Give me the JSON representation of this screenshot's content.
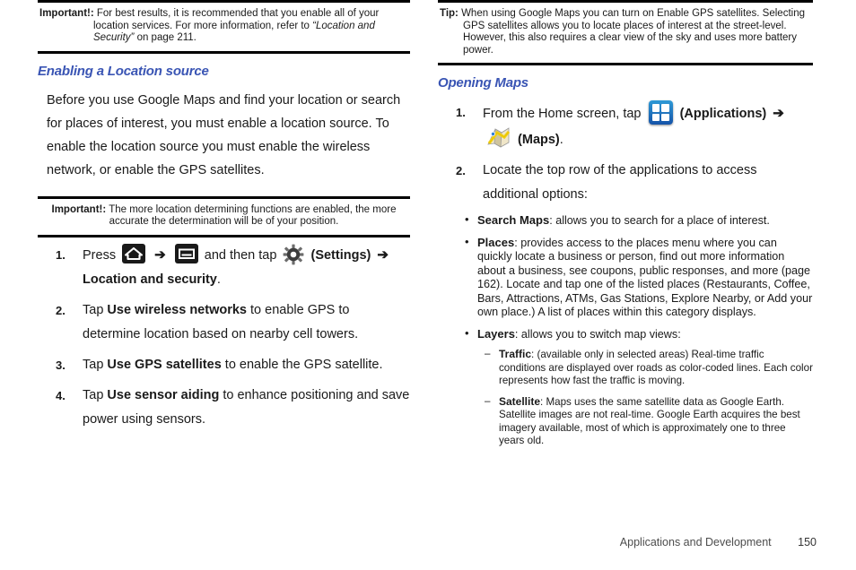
{
  "left_column": {
    "note_important_1": {
      "label": "Important!:",
      "text_a": "For best results, it is recommended that you enable all of your location services. For more information, refer to ",
      "text_italic": "“Location and Security”",
      "text_b": " on page 211."
    },
    "heading": "Enabling a Location source",
    "paragraph": "Before you use Google Maps and find your location or search for places of interest, you must enable a location source. To enable the location source you must enable the wireless network, or enable the GPS satellites.",
    "note_important_2": {
      "label": "Important!:",
      "line1": "The more location determining functions are enabled, the more",
      "line2": "accurate the determination will be of your position."
    },
    "steps": [
      {
        "num": "1.",
        "pre": "Press",
        "home_icon": "home-icon",
        "arrow1": "➔",
        "menu_icon": "menu-icon",
        "mid": "and then tap",
        "gear_icon": "settings-gear-icon",
        "paren_settings": "(Settings)",
        "arrow2": "➔",
        "bold_tail": "Location and security",
        "tail_punct": "."
      },
      {
        "num": "2.",
        "pre": "Tap ",
        "bold": "Use wireless networks",
        "post": " to enable GPS to determine location based on nearby cell towers."
      },
      {
        "num": "3.",
        "pre": "Tap ",
        "bold": "Use GPS satellites",
        "post": " to enable the GPS satellite."
      },
      {
        "num": "4.",
        "pre": "Tap ",
        "bold": "Use sensor aiding",
        "post": " to enhance positioning and save power using sensors."
      }
    ]
  },
  "right_column": {
    "note_tip": {
      "label": "Tip:",
      "text": "When using Google Maps you can turn on Enable GPS satellites. Selecting GPS satellites allows you to locate places of interest at the street-level. However, this also requires a clear view of the sky and uses more battery power."
    },
    "heading": "Opening Maps",
    "steps": [
      {
        "num": "1.",
        "pre": "From the Home screen, tap",
        "apps_icon": "applications-icon",
        "paren_apps": "(Applications)",
        "arrow": "➔",
        "maps_icon": "maps-icon",
        "paren_maps": "(Maps)",
        "tail_punct": "."
      },
      {
        "num": "2.",
        "text": "Locate the top row of the applications to access additional options:"
      }
    ],
    "bullets": [
      {
        "bold": "Search Maps",
        "text": ": allows you to search for a place of interest."
      },
      {
        "bold": "Places",
        "text": ": provides access to the places menu where you can quickly locate a business or person, find out more information about a business, see coupons, public responses, and more (page 162). Locate and tap one of the listed places (Restaurants, Coffee, Bars, Attractions, ATMs, Gas Stations, Explore Nearby, or Add your own place.) A list of places within this category displays."
      },
      {
        "bold": "Layers",
        "text": ": allows you to switch map views:"
      }
    ],
    "subbullets": [
      {
        "dash": "–",
        "bold": "Traffic",
        "text": ": (available only in selected areas) Real-time traffic conditions are displayed over roads as color-coded lines. Each color represents how fast the traffic is moving."
      },
      {
        "dash": "–",
        "bold": "Satellite",
        "text": ": Maps uses the same satellite data as Google Earth. Satellite images are not real-time. Google Earth acquires the best imagery available, most of which is approximately one to three years old."
      }
    ]
  },
  "footer": {
    "chapter": "Applications and Development",
    "page_number": "150"
  },
  "colors": {
    "heading_blue": "#3a55b4",
    "rule_black": "#000000",
    "apps_icon_blue": "#1f72c4",
    "maps_icon_yellow": "#f2d11a"
  }
}
